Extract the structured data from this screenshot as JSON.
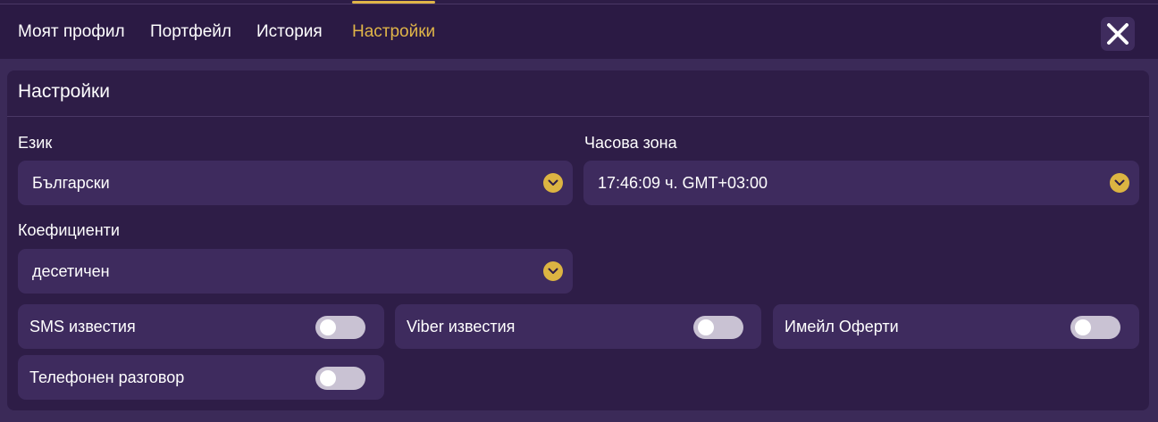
{
  "tabs": [
    {
      "label": "Моят профил",
      "active": false
    },
    {
      "label": "Портфейл",
      "active": false
    },
    {
      "label": "История",
      "active": false
    },
    {
      "label": "Настройки",
      "active": true
    }
  ],
  "close_icon": "close-icon",
  "settings": {
    "title": "Настройки",
    "language": {
      "label": "Език",
      "value": "Български"
    },
    "timezone": {
      "label": "Часова зона",
      "value": "17:46:09 ч. GMT+03:00"
    },
    "odds": {
      "label": "Коефициенти",
      "value": "десетичен"
    },
    "toggles": [
      {
        "label": "SMS известия",
        "on": false
      },
      {
        "label": "Viber известия",
        "on": false
      },
      {
        "label": "Имейл Оферти",
        "on": false
      },
      {
        "label": "Телефонен разговор",
        "on": false
      }
    ]
  },
  "colors": {
    "background": "#2e1d47",
    "surface": "#3e2b5e",
    "accent": "#e0b548",
    "toggle_off": "#c9c2d3"
  }
}
